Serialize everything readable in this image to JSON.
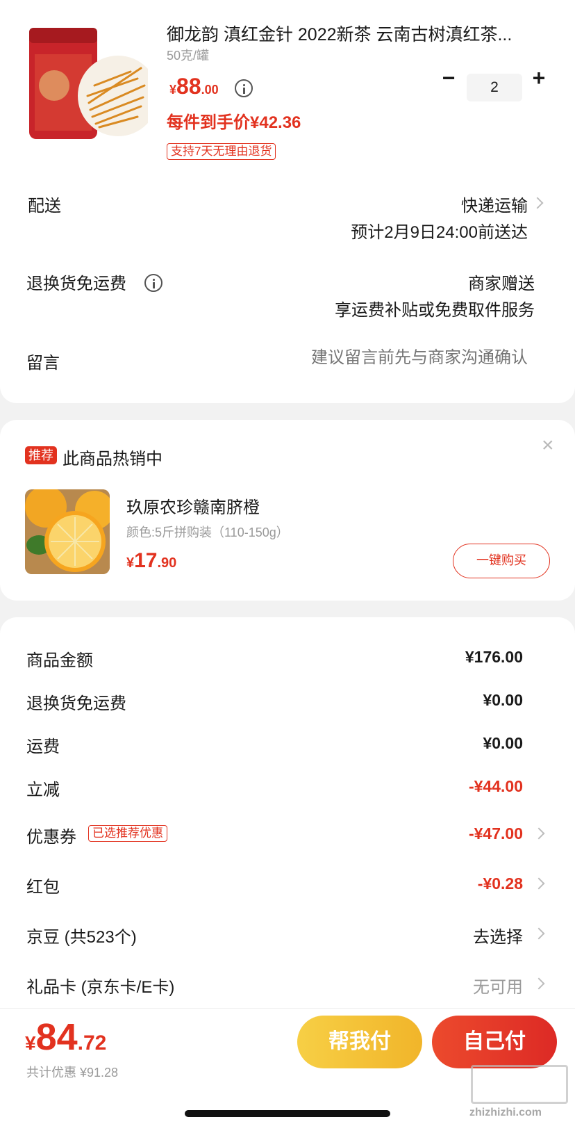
{
  "product": {
    "title": "御龙韵 滇红金针 2022新茶 云南古树滇红茶...",
    "spec": "50克/罐",
    "price_symbol": "¥",
    "price_int": "88",
    "price_dec": ".00",
    "per_item_price": "每件到手价¥42.36",
    "return_tag": "支持7天无理由退货",
    "quantity": "2",
    "minus": "−",
    "plus": "+"
  },
  "delivery": {
    "label": "配送",
    "method": "快递运输",
    "eta": "预计2月9日24:00前送达"
  },
  "return_shipping": {
    "label": "退换货免运费",
    "value": "商家赠送",
    "desc": "享运费补贴或免费取件服务"
  },
  "message": {
    "label": "留言",
    "placeholder": "建议留言前先与商家沟通确认"
  },
  "recommend": {
    "tag": "推荐",
    "headline": "此商品热销中",
    "close": "×",
    "name": "玖原农珍赣南脐橙",
    "spec": "颜色:5斤拼购装（110-150g）",
    "price_symbol": "¥",
    "price_int": "17",
    "price_dec": ".90",
    "buy_button": "一键购买"
  },
  "summary": {
    "rows": [
      {
        "label": "商品金额",
        "value": "¥176.00"
      },
      {
        "label": "退换货免运费",
        "value": "¥0.00"
      },
      {
        "label": "运费",
        "value": "¥0.00"
      },
      {
        "label": "立减",
        "value": "-¥44.00"
      },
      {
        "label": "优惠券",
        "tag": "已选推荐优惠",
        "value": "-¥47.00"
      },
      {
        "label": "红包",
        "value": "-¥0.28"
      },
      {
        "label": "京豆 (共523个)",
        "value": "去选择"
      },
      {
        "label": "礼品卡 (京东卡/E卡)",
        "value": "无可用"
      }
    ]
  },
  "footer": {
    "total_symbol": "¥",
    "total_int": "84",
    "total_dec": ".72",
    "discount_total": "共计优惠 ¥91.28",
    "help_pay": "帮我付",
    "self_pay": "自己付"
  },
  "watermark": "zhizhizhi.com",
  "colors": {
    "accent_red": "#e2321f",
    "help_pay_yellow": "#f4c235",
    "self_pay_red": "#e3342a"
  }
}
